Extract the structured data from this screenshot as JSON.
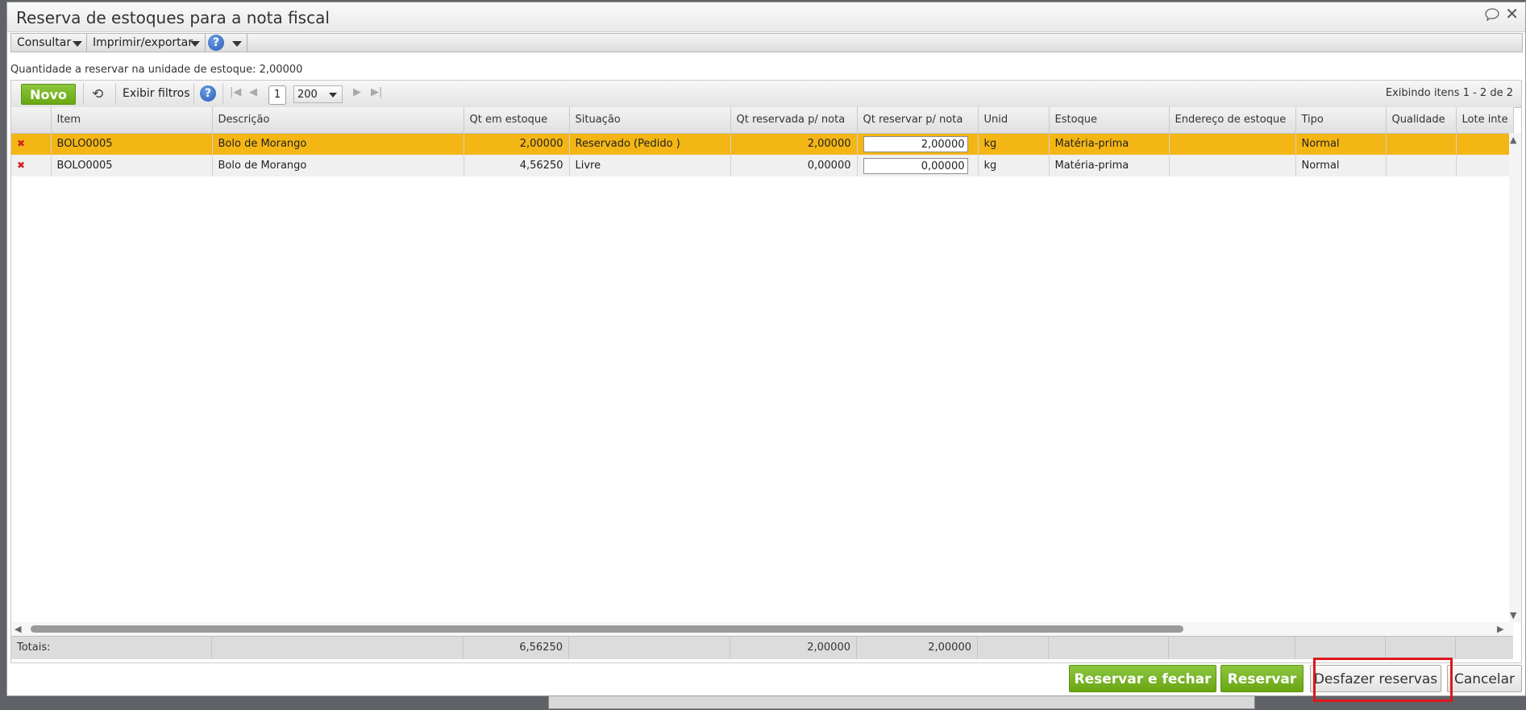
{
  "window": {
    "title": "Reserva de estoques para a nota fiscal"
  },
  "menubar": {
    "consultar": "Consultar",
    "imprimir": "Imprimir/exportar",
    "help": "?"
  },
  "info": "Quantidade a reservar na unidade de estoque: 2,00000",
  "toolbar": {
    "novo": "Novo",
    "exibir_filtros": "Exibir filtros",
    "help": "?",
    "page": "1",
    "per_page": "200",
    "range": "Exibindo itens 1 - 2 de 2"
  },
  "columns": [
    "",
    "Item",
    "Descrição",
    "Qt em estoque",
    "Situação",
    "Qt reservada p/ nota",
    "Qt reservar p/ nota",
    "Unid",
    "Estoque",
    "Endereço de estoque",
    "Tipo",
    "Qualidade",
    "Lote inte"
  ],
  "rows": [
    {
      "item": "BOLO0005",
      "descricao": "Bolo de Morango",
      "qt_estoque": "2,00000",
      "situacao": "Reservado (Pedido )",
      "qt_reservada": "2,00000",
      "qt_reservar": "2,00000",
      "unid": "kg",
      "estoque": "Matéria-prima",
      "endereco": "",
      "tipo": "Normal",
      "qualidade": "",
      "lote": ""
    },
    {
      "item": "BOLO0005",
      "descricao": "Bolo de Morango",
      "qt_estoque": "4,56250",
      "situacao": "Livre",
      "qt_reservada": "0,00000",
      "qt_reservar": "0,00000",
      "unid": "kg",
      "estoque": "Matéria-prima",
      "endereco": "",
      "tipo": "Normal",
      "qualidade": "",
      "lote": ""
    }
  ],
  "totals": {
    "label": "Totais:",
    "qt_estoque": "6,56250",
    "qt_reservada": "2,00000",
    "qt_reservar": "2,00000"
  },
  "footer": {
    "reservar_fechar": "Reservar e fechar",
    "reservar": "Reservar",
    "desfazer": "Desfazer reservas",
    "cancelar": "Cancelar"
  },
  "colors": {
    "selected_row": "#f4b614",
    "accent_green": "#7ab82a",
    "highlight_box": "#e0161b"
  },
  "icons": [
    "comment-icon",
    "close-icon",
    "caret-down-icon",
    "help-icon",
    "refresh-icon",
    "first-page-icon",
    "prev-page-icon",
    "next-page-icon",
    "last-page-icon",
    "remove-row-icon"
  ]
}
